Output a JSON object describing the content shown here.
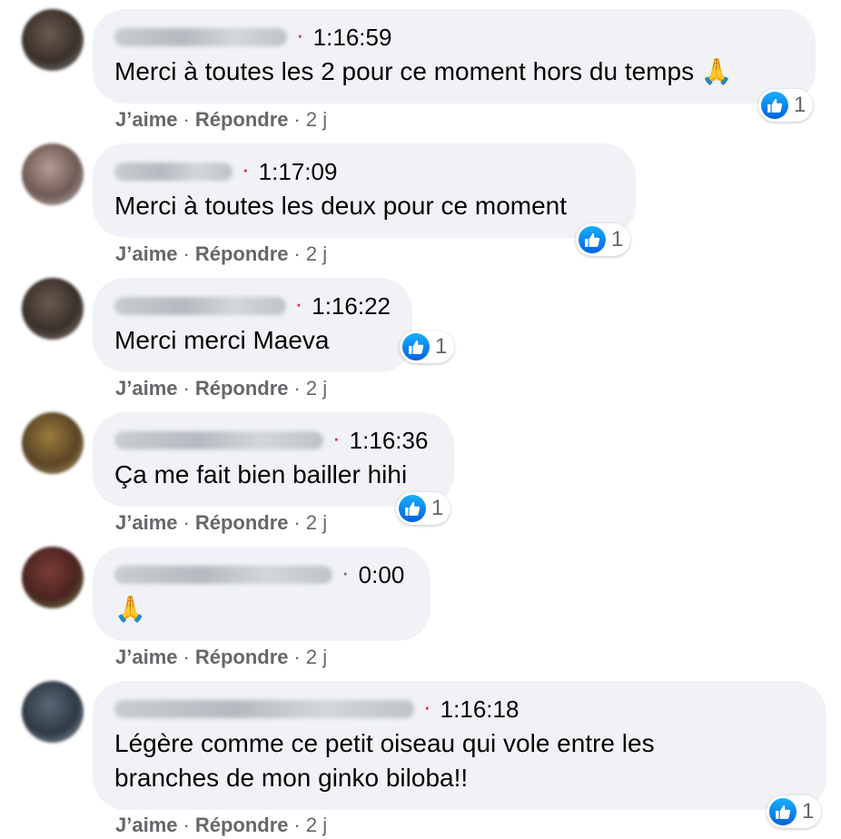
{
  "comments": [
    {
      "time": "1:16:59",
      "dot_color": "#e41e3f",
      "text": "Merci à toutes les 2 pour ce moment hors du temps",
      "emoji": "🙏",
      "reaction_count": "1",
      "like": "J’aime",
      "reply": "Répondre",
      "age": "2 j"
    },
    {
      "time": "1:17:09",
      "dot_color": "#e41e3f",
      "text": "Merci à toutes les deux pour ce moment",
      "emoji": "",
      "reaction_count": "1",
      "like": "J’aime",
      "reply": "Répondre",
      "age": "2 j"
    },
    {
      "time": "1:16:22",
      "dot_color": "#e41e3f",
      "text": "Merci merci Maeva",
      "emoji": "",
      "reaction_count": "1",
      "like": "J’aime",
      "reply": "Répondre",
      "age": "2 j"
    },
    {
      "time": "1:16:36",
      "dot_color": "#e41e3f",
      "text": "Ça me fait bien bailler hihi",
      "emoji": "",
      "reaction_count": "1",
      "like": "J’aime",
      "reply": "Répondre",
      "age": "2 j"
    },
    {
      "time": "0:00",
      "dot_color": "#65676b",
      "text": "",
      "emoji": "🙏",
      "reaction_count": "",
      "like": "J’aime",
      "reply": "Répondre",
      "age": "2 j"
    },
    {
      "time": "1:16:18",
      "dot_color": "#e41e3f",
      "text": "Légère comme ce petit oiseau qui vole entre les branches de mon ginko biloba!!",
      "emoji": "",
      "reaction_count": "1",
      "like": "J’aime",
      "reply": "Répondre",
      "age": "2 j"
    }
  ],
  "separator": "·",
  "reaction_icon": "like-thumb-icon",
  "colors": {
    "bubble": "#f0f2f5",
    "like_blue": "#1877f2",
    "secondary_text": "#65676b"
  }
}
